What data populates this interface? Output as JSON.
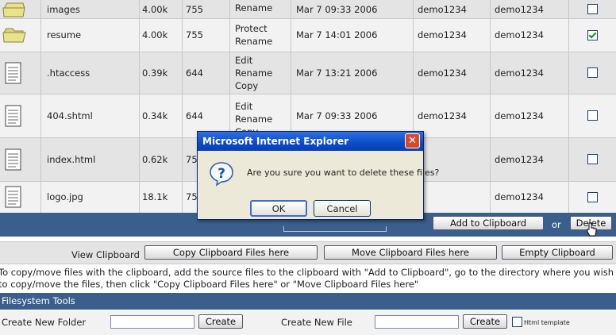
{
  "files": [
    {
      "name": "images",
      "size": "4.00k",
      "perm": "755",
      "ops": [
        "",
        "Rename"
      ],
      "date": "Mar 7 09:33 2006",
      "user": "demo1234",
      "group": "demo1234",
      "checked": false,
      "icon": "folder-icon"
    },
    {
      "name": "resume",
      "size": "4.00k",
      "perm": "755",
      "ops": [
        "Protect",
        "Rename"
      ],
      "date": "Mar 7 14:01 2006",
      "user": "demo1234",
      "group": "demo1234",
      "checked": true,
      "icon": "folder-icon"
    },
    {
      "name": ".htaccess",
      "size": "0.39k",
      "perm": "644",
      "ops": [
        "Edit",
        "Rename",
        "Copy"
      ],
      "date": "Mar 7 13:21 2006",
      "user": "demo1234",
      "group": "demo1234",
      "checked": false,
      "icon": "document-icon"
    },
    {
      "name": "404.shtml",
      "size": "0.34k",
      "perm": "644",
      "ops": [
        "Edit",
        "Rename",
        "Copy"
      ],
      "date": "Mar 7 09:33 2006",
      "user": "demo1234",
      "group": "demo1234",
      "checked": false,
      "icon": "document-icon"
    },
    {
      "name": "index.html",
      "size": "0.62k",
      "perm": "755",
      "ops": [],
      "date": "",
      "user": "",
      "group": "demo1234",
      "checked": false,
      "icon": "document-icon"
    },
    {
      "name": "logo.jpg",
      "size": "18.1k",
      "perm": "755",
      "ops": [],
      "date": "",
      "user": "",
      "group": "demo1234",
      "checked": false,
      "icon": "document-icon"
    }
  ],
  "actions": {
    "add_to_clipboard": "Add to Clipboard",
    "or": "or",
    "delete": "Delete"
  },
  "clipboard": {
    "label": "View Clipboard",
    "copy": "Copy Clipboard Files here",
    "move": "Move Clipboard Files here",
    "empty": "Empty Clipboard",
    "help1": "To copy/move files with the clipboard, add the source files to the clipboard with \"Add to Clipboard\", go to the directory where you wish",
    "help2": "to copy/move the files, then click \"Copy Clipboard Files here\" or \"Move Clipboard Files here\""
  },
  "tools": {
    "header": "Filesystem Tools",
    "new_folder": "Create New Folder",
    "create": "Create",
    "new_file": "Create New File",
    "html_template": "Html template"
  },
  "dialog": {
    "title": "Microsoft Internet Explorer",
    "message": "Are you sure you want to delete these files?",
    "ok": "OK",
    "cancel": "Cancel",
    "close_glyph": "✕"
  },
  "colors": {
    "bar": "#3b5f8c",
    "dialog_title": "#0a4bc9",
    "checkbox_border": "#1c3f73"
  }
}
